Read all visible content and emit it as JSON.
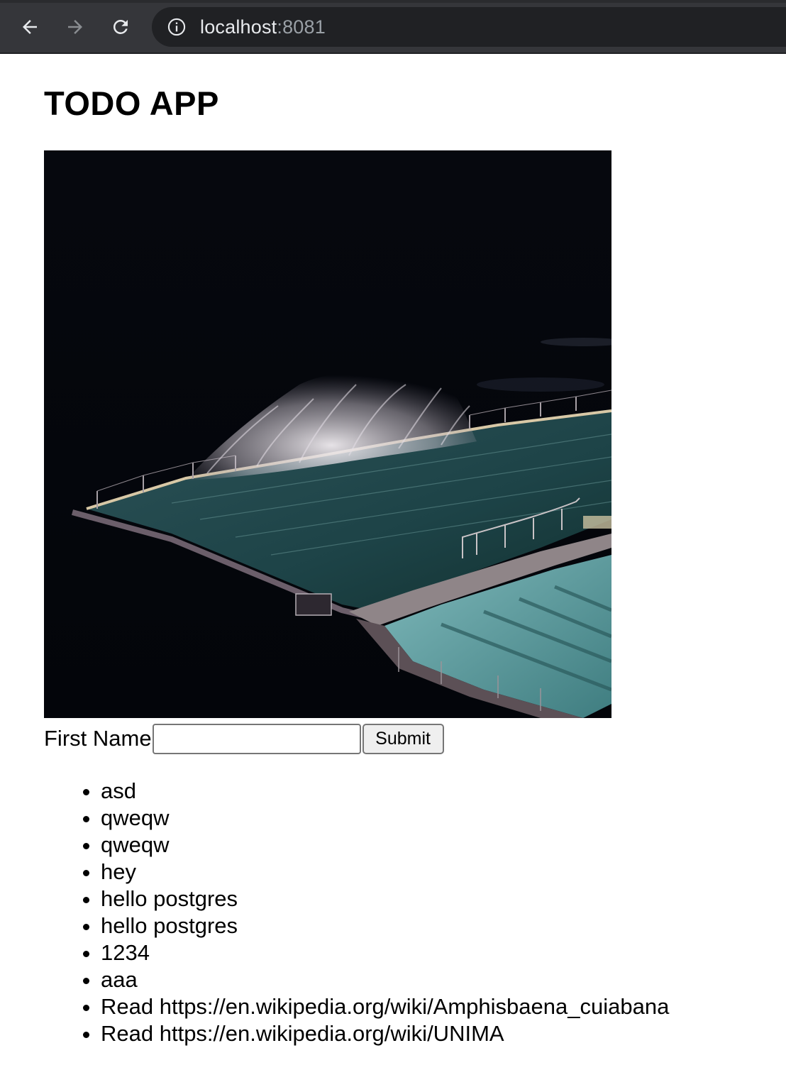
{
  "browser": {
    "url_host": "localhost",
    "url_port": ":8081",
    "back_icon": "arrow-left-icon",
    "forward_icon": "arrow-right-icon",
    "reload_icon": "reload-icon",
    "info_icon": "info-icon"
  },
  "page": {
    "title": "TODO APP"
  },
  "form": {
    "label": "First Name",
    "input_value": "",
    "input_placeholder": "",
    "submit_label": "Submit"
  },
  "todos": [
    "asd",
    "qweqw",
    "qweqw",
    "hey",
    "hello postgres",
    "hello postgres",
    "1234",
    "aaa",
    "Read https://en.wikipedia.org/wiki/Amphisbaena_cuiabana",
    "Read https://en.wikipedia.org/wiki/UNIMA"
  ],
  "colors": {
    "toolbar_bg": "#35363a",
    "omnibox_bg": "#202124",
    "image_bg": "#05070d",
    "pool_water": "#1f4a4c",
    "pool_shallow": "#5d9ea2"
  }
}
